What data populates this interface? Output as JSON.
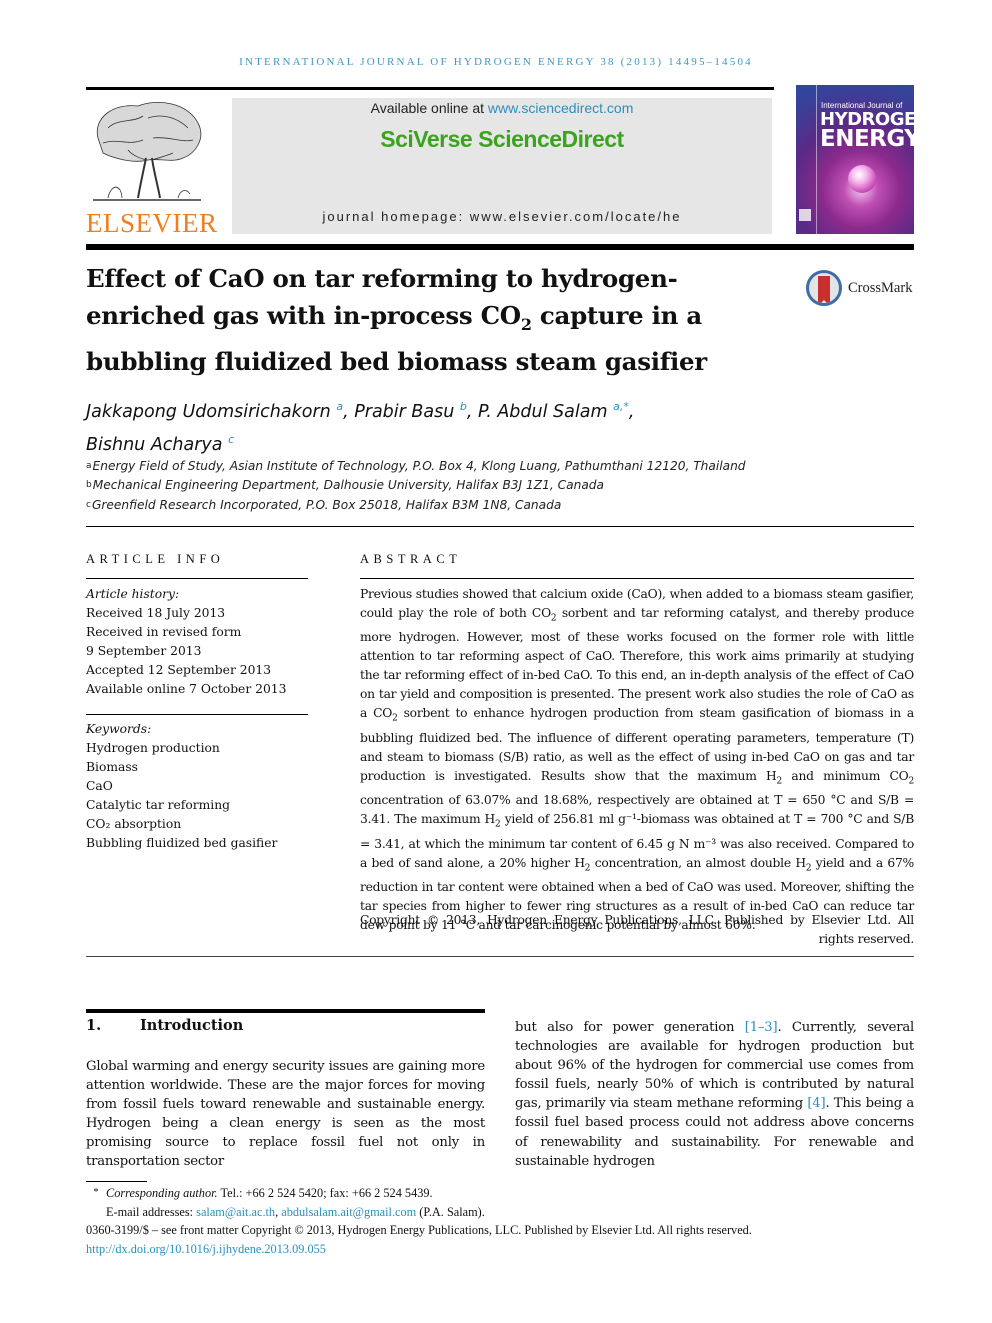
{
  "running_head": "INTERNATIONAL JOURNAL OF HYDROGEN ENERGY 38 (2013) 14495–14504",
  "masthead": {
    "publisher_name": "ELSEVIER",
    "available_online_prefix": "Available online at ",
    "available_online_link": "www.sciencedirect.com",
    "brand": "SciVerse ScienceDirect",
    "homepage": "journal homepage: www.elsevier.com/locate/he",
    "cover": {
      "small_title": "International Journal of",
      "big_title_line1": "HYDROGEN",
      "big_title_line2": "ENERGY"
    }
  },
  "crossmark_label": "CrossMark",
  "title": {
    "line1": "Effect of CaO on tar reforming to hydrogen-",
    "line2_pre": "enriched gas with in-process CO",
    "line2_sub": "2",
    "line2_post": " capture in a",
    "line3": "bubbling fluidized bed biomass steam gasifier"
  },
  "authors": [
    {
      "name": "Jakkapong Udomsirichakorn",
      "aff": "a",
      "sep": ", "
    },
    {
      "name": "Prabir Basu",
      "aff": "b",
      "sep": ", "
    },
    {
      "name": "P. Abdul Salam",
      "aff": "a,*",
      "sep": ","
    },
    {
      "name": "Bishnu Acharya",
      "aff": "c",
      "sep": ""
    }
  ],
  "affiliations": [
    {
      "mark": "a",
      "text": "Energy Field of Study, Asian Institute of Technology, P.O. Box 4, Klong Luang, Pathumthani 12120, Thailand"
    },
    {
      "mark": "b",
      "text": "Mechanical Engineering Department, Dalhousie University, Halifax B3J 1Z1, Canada"
    },
    {
      "mark": "c",
      "text": "Greenfield Research Incorporated, P.O. Box 25018, Halifax B3M 1N8, Canada"
    }
  ],
  "article_info": {
    "heading": "ARTICLE INFO",
    "history_heading": "Article history:",
    "history": [
      "Received 18 July 2013",
      "Received in revised form",
      "9 September 2013",
      "Accepted 12 September 2013",
      "Available online 7 October 2013"
    ],
    "keywords_heading": "Keywords:",
    "keywords": [
      "Hydrogen production",
      "Biomass",
      "CaO",
      "Catalytic tar reforming",
      "CO₂ absorption",
      "Bubbling fluidized bed gasifier"
    ]
  },
  "abstract": {
    "heading": "ABSTRACT",
    "text_parts": [
      "Previous studies showed that calcium oxide (CaO), when added to a biomass steam gasifier, could play the role of both CO",
      "2",
      " sorbent and tar reforming catalyst, and thereby produce more hydrogen. However, most of these works focused on the former role with little attention to tar reforming aspect of CaO. Therefore, this work aims primarily at studying the tar reforming effect of in-bed CaO. To this end, an in-depth analysis of the effect of CaO on tar yield and composition is presented. The present work also studies the role of CaO as a CO",
      "2",
      " sorbent to enhance hydrogen production from steam gasification of biomass in a bubbling fluidized bed. The influence of different operating parameters, temperature (T) and steam to biomass (S/B) ratio, as well as the effect of using in-bed CaO on gas and tar production is investigated. Results show that the maximum H",
      "2",
      " and minimum CO",
      "2",
      " concentration of 63.07% and 18.68%, respectively are obtained at T = 650 °C and S/B = 3.41. The maximum H",
      "2",
      " yield of 256.81 ml g⁻¹-biomass was obtained at T = 700 °C and S/B = 3.41, at which the minimum tar content of 6.45 g N m⁻³ was also received. Compared to a bed of sand alone, a 20% higher H",
      "2",
      " concentration, an almost double H",
      "2",
      " yield and a 67% reduction in tar content were obtained when a bed of CaO was used. Moreover, shifting the tar species from higher to fewer ring structures as a result of in-bed CaO can reduce tar dew point by 11 °C and tar carcinogenic potential by almost 60%."
    ],
    "copyright": "Copyright © 2013, Hydrogen Energy Publications, LLC. Published by Elsevier Ltd. All rights reserved."
  },
  "introduction": {
    "number": "1.",
    "heading": "Introduction",
    "col1": "Global warming and energy security issues are gaining more attention worldwide. These are the major forces for moving from fossil fuels toward renewable and sustainable energy. Hydrogen being a clean energy is seen as the most promising source to replace fossil fuel not only in transportation sector",
    "col2_a": "but also for power generation ",
    "col2_ref1": "[1–3]",
    "col2_b": ". Currently, several technologies are available for hydrogen production but about 96% of the hydrogen for commercial use comes from fossil fuels, nearly 50% of which is contributed by natural gas, primarily via steam methane reforming ",
    "col2_ref2": "[4]",
    "col2_c": ". This being a fossil fuel based process could not address above concerns of renewability and sustainability. For renewable and sustainable hydrogen"
  },
  "footnotes": {
    "star": "*",
    "corresponding_label": "Corresponding author.",
    "contact": " Tel.: +66 2 524 5420; fax: +66 2 524 5439.",
    "email_prefix": "E-mail addresses: ",
    "email1": "salam@ait.ac.th",
    "email_sep": ", ",
    "email2": "abdulsalam.ait@gmail.com",
    "email_suffix": " (P.A. Salam).",
    "issn_line": "0360-3199/$ – see front matter Copyright © 2013, Hydrogen Energy Publications, LLC. Published by Elsevier Ltd. All rights reserved.",
    "doi": "http://dx.doi.org/10.1016/j.ijhydene.2013.09.055"
  },
  "colors": {
    "link": "#2a8fbf",
    "running_head": "#3b9ac4",
    "elsevier_orange": "#f07f1b",
    "sciverse_green": "#3ca31c",
    "banner_gray": "#e6e6e6"
  }
}
